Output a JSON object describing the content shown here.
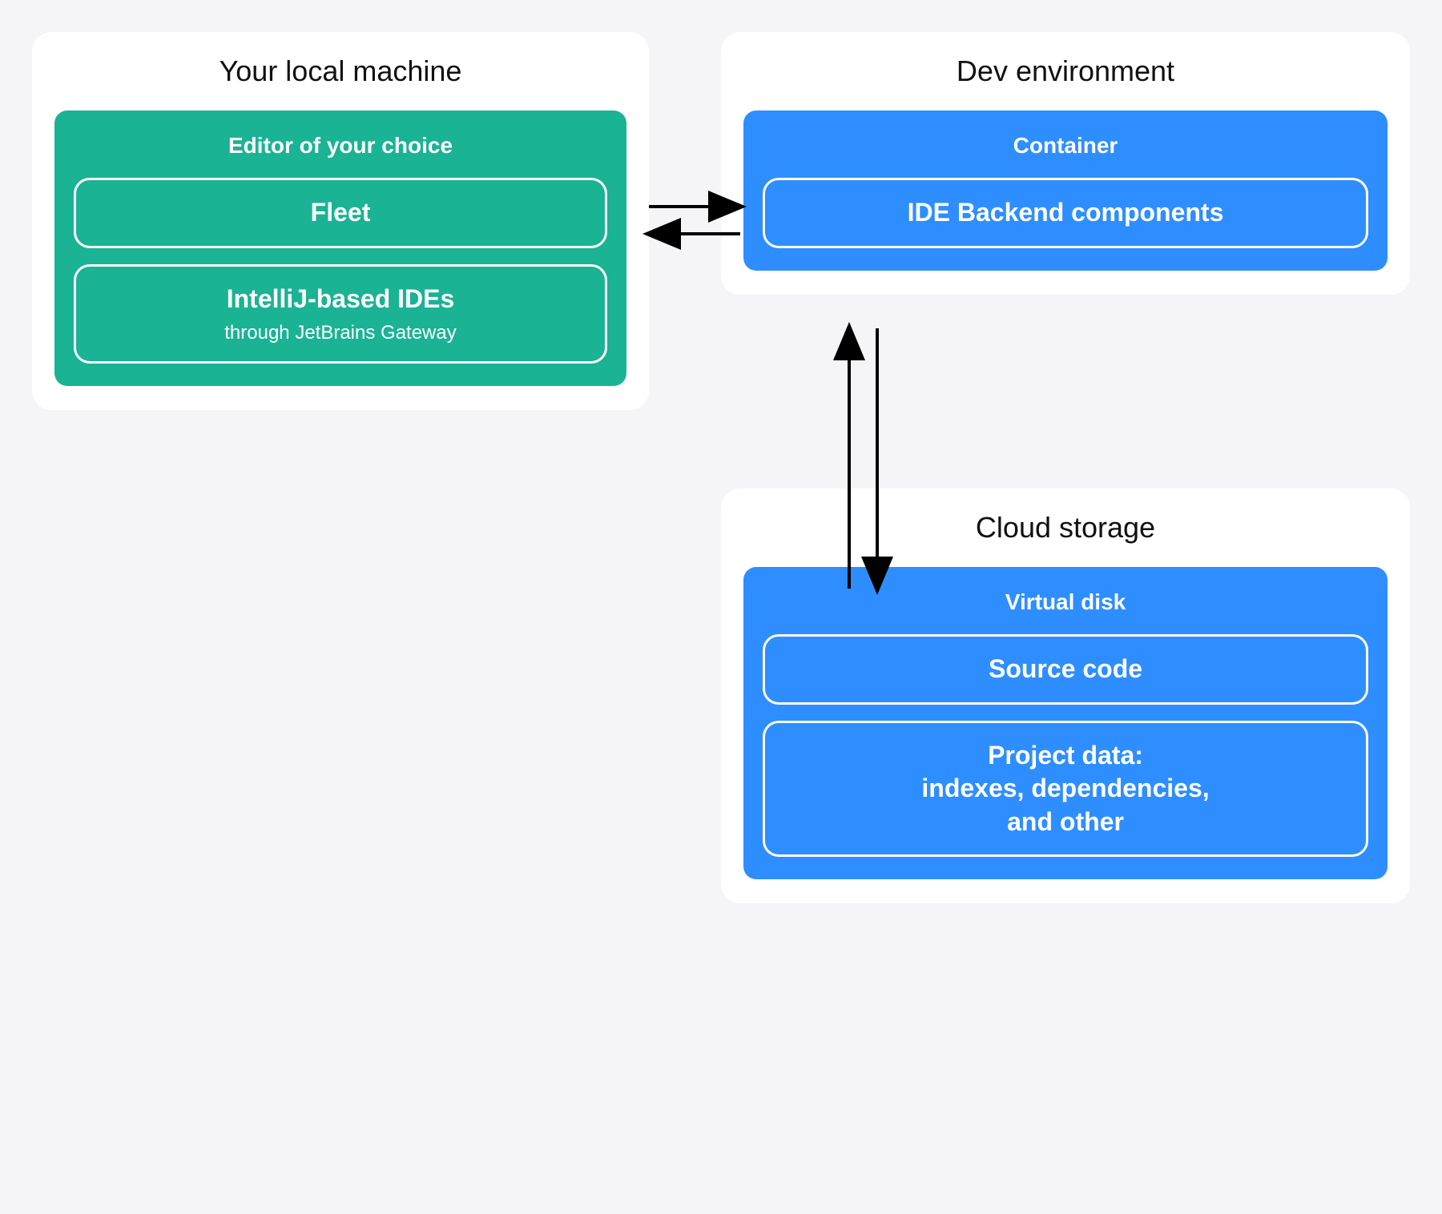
{
  "colors": {
    "background": "#f5f5f7",
    "card": "#ffffff",
    "teal": "#1ab394",
    "blue": "#2e8eff",
    "text": "#111111",
    "pillBorder": "#ffffff"
  },
  "local": {
    "title": "Your local machine",
    "panel": {
      "title": "Editor of your choice",
      "items": [
        {
          "title": "Fleet",
          "sub": ""
        },
        {
          "title": "IntelliJ-based IDEs",
          "sub": "through JetBrains Gateway"
        }
      ]
    }
  },
  "dev": {
    "title": "Dev environment",
    "panel": {
      "title": "Container",
      "items": [
        {
          "title": "IDE Backend components",
          "sub": ""
        }
      ]
    }
  },
  "cloud": {
    "title": "Cloud storage",
    "panel": {
      "title": "Virtual disk",
      "items": [
        {
          "title": "Source code",
          "sub": ""
        },
        {
          "title": "Project data:\nindexes, dependencies,\nand other",
          "sub": ""
        }
      ]
    }
  },
  "connections": [
    {
      "from": "local.panel",
      "to": "dev.panel",
      "type": "bidirectional-horizontal"
    },
    {
      "from": "dev.panel",
      "to": "cloud.panel",
      "type": "bidirectional-vertical"
    }
  ]
}
